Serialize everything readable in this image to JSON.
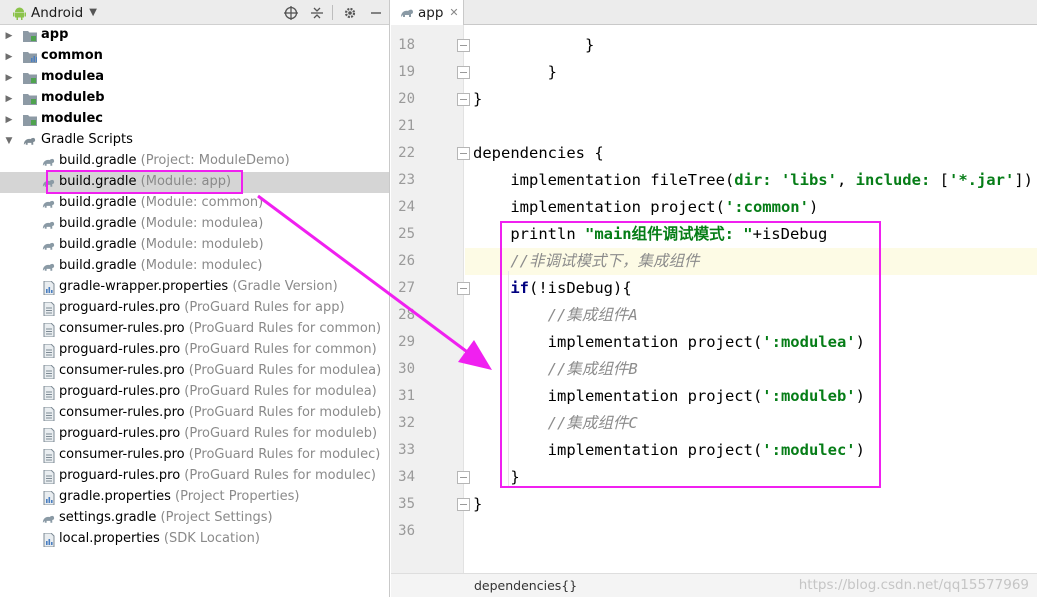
{
  "project_panel": {
    "view_mode": "Android",
    "tree": [
      {
        "label": "app",
        "hint": "",
        "kind": "module",
        "bold": true
      },
      {
        "label": "common",
        "hint": "",
        "kind": "library",
        "bold": true
      },
      {
        "label": "modulea",
        "hint": "",
        "kind": "module",
        "bold": true
      },
      {
        "label": "moduleb",
        "hint": "",
        "kind": "module",
        "bold": true
      },
      {
        "label": "modulec",
        "hint": "",
        "kind": "module",
        "bold": true
      },
      {
        "label": "Gradle Scripts",
        "hint": "",
        "kind": "gradle-scripts",
        "bold": false
      },
      {
        "label": "build.gradle",
        "hint": "(Project: ModuleDemo)",
        "kind": "gradle"
      },
      {
        "label": "build.gradle",
        "hint": "(Module: app)",
        "kind": "gradle",
        "selected": true
      },
      {
        "label": "build.gradle",
        "hint": "(Module: common)",
        "kind": "gradle"
      },
      {
        "label": "build.gradle",
        "hint": "(Module: modulea)",
        "kind": "gradle"
      },
      {
        "label": "build.gradle",
        "hint": "(Module: moduleb)",
        "kind": "gradle"
      },
      {
        "label": "build.gradle",
        "hint": "(Module: modulec)",
        "kind": "gradle"
      },
      {
        "label": "gradle-wrapper.properties",
        "hint": "(Gradle Version)",
        "kind": "properties"
      },
      {
        "label": "proguard-rules.pro",
        "hint": "(ProGuard Rules for app)",
        "kind": "file"
      },
      {
        "label": "consumer-rules.pro",
        "hint": "(ProGuard Rules for common)",
        "kind": "file"
      },
      {
        "label": "proguard-rules.pro",
        "hint": "(ProGuard Rules for common)",
        "kind": "file"
      },
      {
        "label": "consumer-rules.pro",
        "hint": "(ProGuard Rules for modulea)",
        "kind": "file"
      },
      {
        "label": "proguard-rules.pro",
        "hint": "(ProGuard Rules for modulea)",
        "kind": "file"
      },
      {
        "label": "consumer-rules.pro",
        "hint": "(ProGuard Rules for moduleb)",
        "kind": "file"
      },
      {
        "label": "proguard-rules.pro",
        "hint": "(ProGuard Rules for moduleb)",
        "kind": "file"
      },
      {
        "label": "consumer-rules.pro",
        "hint": "(ProGuard Rules for modulec)",
        "kind": "file"
      },
      {
        "label": "proguard-rules.pro",
        "hint": "(ProGuard Rules for modulec)",
        "kind": "file"
      },
      {
        "label": "gradle.properties",
        "hint": "(Project Properties)",
        "kind": "properties"
      },
      {
        "label": "settings.gradle",
        "hint": "(Project Settings)",
        "kind": "gradle"
      },
      {
        "label": "local.properties",
        "hint": "(SDK Location)",
        "kind": "properties"
      }
    ]
  },
  "editor": {
    "tab_label": "app",
    "breadcrumb": "dependencies{}",
    "current_line": 26,
    "lines": [
      {
        "n": "18",
        "parts": [
          {
            "t": "            }",
            "c": "plain"
          }
        ]
      },
      {
        "n": "19",
        "parts": [
          {
            "t": "        }",
            "c": "plain"
          }
        ]
      },
      {
        "n": "20",
        "parts": [
          {
            "t": "}",
            "c": "plain"
          }
        ]
      },
      {
        "n": "21",
        "parts": []
      },
      {
        "n": "22",
        "parts": [
          {
            "t": "dependencies {",
            "c": "plain"
          }
        ]
      },
      {
        "n": "23",
        "parts": [
          {
            "t": "    implementation fileTree(",
            "c": "plain"
          },
          {
            "t": "dir: ",
            "c": "named"
          },
          {
            "t": "'libs'",
            "c": "str"
          },
          {
            "t": ", ",
            "c": "plain"
          },
          {
            "t": "include: ",
            "c": "named"
          },
          {
            "t": "[",
            "c": "plain"
          },
          {
            "t": "'*.jar'",
            "c": "str"
          },
          {
            "t": "])",
            "c": "plain"
          }
        ]
      },
      {
        "n": "24",
        "parts": [
          {
            "t": "    implementation project(",
            "c": "plain"
          },
          {
            "t": "':common'",
            "c": "str"
          },
          {
            "t": ")",
            "c": "plain"
          }
        ]
      },
      {
        "n": "25",
        "parts": [
          {
            "t": "    println ",
            "c": "plain"
          },
          {
            "t": "\"main组件调试模式: \"",
            "c": "str"
          },
          {
            "t": "+isDebug",
            "c": "plain"
          }
        ]
      },
      {
        "n": "26",
        "parts": [
          {
            "t": "    //非调试模式下，集成组件",
            "c": "cmt"
          }
        ]
      },
      {
        "n": "27",
        "parts": [
          {
            "t": "    ",
            "c": "plain"
          },
          {
            "t": "if",
            "c": "kw"
          },
          {
            "t": "(!isDebug){",
            "c": "plain"
          }
        ]
      },
      {
        "n": "28",
        "parts": [
          {
            "t": "        //集成组件A",
            "c": "cmt"
          }
        ]
      },
      {
        "n": "29",
        "parts": [
          {
            "t": "        implementation project(",
            "c": "plain"
          },
          {
            "t": "':modulea'",
            "c": "str"
          },
          {
            "t": ")",
            "c": "plain"
          }
        ]
      },
      {
        "n": "30",
        "parts": [
          {
            "t": "        //集成组件B",
            "c": "cmt"
          }
        ]
      },
      {
        "n": "31",
        "parts": [
          {
            "t": "        implementation project(",
            "c": "plain"
          },
          {
            "t": "':moduleb'",
            "c": "str"
          },
          {
            "t": ")",
            "c": "plain"
          }
        ]
      },
      {
        "n": "32",
        "parts": [
          {
            "t": "        //集成组件C",
            "c": "cmt"
          }
        ]
      },
      {
        "n": "33",
        "parts": [
          {
            "t": "        implementation project(",
            "c": "plain"
          },
          {
            "t": "':modulec'",
            "c": "str"
          },
          {
            "t": ")",
            "c": "plain"
          }
        ]
      },
      {
        "n": "34",
        "parts": [
          {
            "t": "    }",
            "c": "plain"
          }
        ]
      },
      {
        "n": "35",
        "parts": [
          {
            "t": "}",
            "c": "plain"
          }
        ]
      },
      {
        "n": "36",
        "parts": []
      }
    ]
  },
  "watermark": "https://blog.csdn.net/qq15577969",
  "colors": {
    "annotation": "#f020f0",
    "string": "#067d17",
    "comment": "#8c8c8c",
    "keyword": "#000080",
    "selection": "#d5d5d5",
    "current_line": "#fdfbe5"
  }
}
